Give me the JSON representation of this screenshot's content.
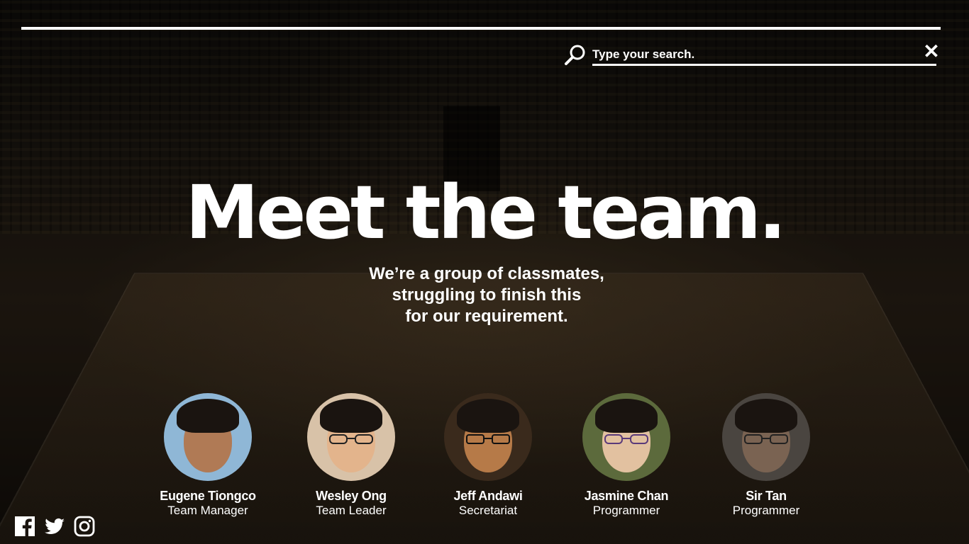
{
  "search": {
    "placeholder": "Type your search."
  },
  "hero": {
    "title": "Meet the team.",
    "tagline": [
      "We’re a group of classmates,",
      "struggling to finish this",
      "for our requirement."
    ]
  },
  "team": [
    {
      "name": "Eugene Tiongco",
      "role": "Team Manager",
      "bg": "#8fb7d6",
      "skin": "#b07a55"
    },
    {
      "name": "Wesley Ong",
      "role": "Team Leader",
      "bg": "#d8c2a8",
      "skin": "#e3b48c"
    },
    {
      "name": "Jeff Andawi",
      "role": "Secretariat",
      "bg": "#3a2a1c",
      "skin": "#b67a48"
    },
    {
      "name": "Jasmine Chan",
      "role": "Programmer",
      "bg": "#5c6a3c",
      "skin": "#e2c1a0"
    },
    {
      "name": "Sir Tan",
      "role": "Programmer",
      "bg": "#4a4540",
      "skin": "#7a6352"
    }
  ],
  "social": {
    "icons": [
      "facebook-icon",
      "twitter-icon",
      "instagram-icon"
    ]
  }
}
